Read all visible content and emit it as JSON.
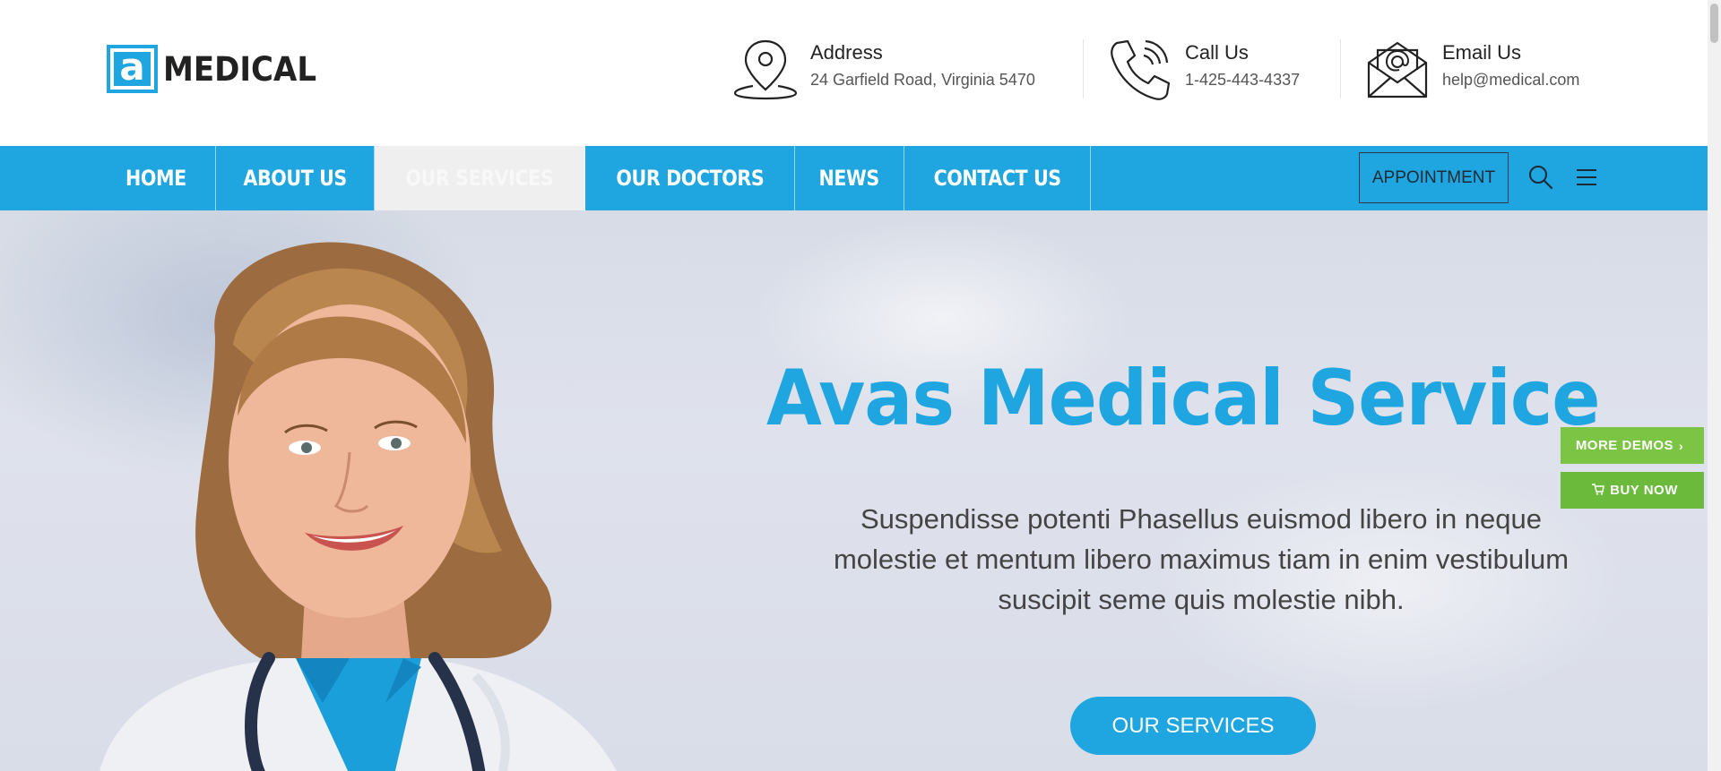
{
  "brand": {
    "logo_letter": "a",
    "logo_text": "MEDICAL",
    "accent": "#1fa5e0"
  },
  "contacts": [
    {
      "label": "Address",
      "value": "24 Garfield Road, Virginia 5470",
      "icon": "location-pin-icon"
    },
    {
      "label": "Call Us",
      "value": "1-425-443-4337",
      "icon": "phone-icon"
    },
    {
      "label": "Email Us",
      "value": "help@medical.com",
      "icon": "envelope-icon"
    }
  ],
  "nav": {
    "items": [
      {
        "label": "HOME"
      },
      {
        "label": "ABOUT US"
      },
      {
        "label": "OUR SERVICES",
        "active": true
      },
      {
        "label": "OUR DOCTORS"
      },
      {
        "label": "NEWS"
      },
      {
        "label": "CONTACT US"
      }
    ],
    "appointment_label": "APPOINTMENT",
    "search_icon": "search-icon",
    "menu_icon": "hamburger-menu-icon"
  },
  "hero": {
    "title": "Avas Medical Service",
    "description": "Suspendisse potenti Phasellus euismod libero in neque molestie et mentum libero maximus tiam in enim vestibulum suscipit seme quis molestie nibh.",
    "button_label": "OUR SERVICES"
  },
  "side_buttons": {
    "more_demos": "MORE DEMOS",
    "buy_now": "BUY NOW",
    "color": "#6dbb3f"
  }
}
